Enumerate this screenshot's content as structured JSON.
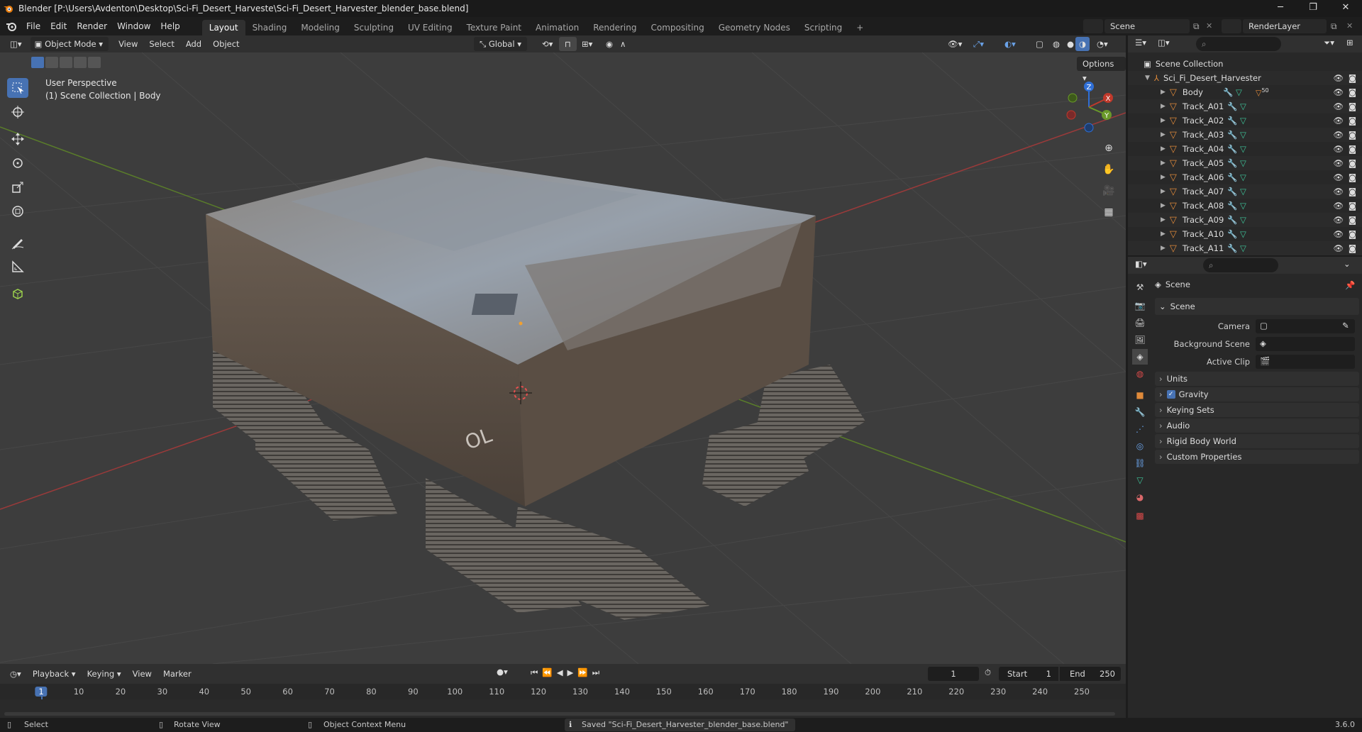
{
  "window": {
    "title": "Blender [P:\\Users\\Avdenton\\Desktop\\Sci-Fi_Desert_Harveste\\Sci-Fi_Desert_Harvester_blender_base.blend]",
    "minimize": "─",
    "maximize": "❐",
    "close": "✕"
  },
  "menus": [
    "File",
    "Edit",
    "Render",
    "Window",
    "Help"
  ],
  "workspaces": [
    "Layout",
    "Shading",
    "Modeling",
    "Sculpting",
    "UV Editing",
    "Texture Paint",
    "Animation",
    "Rendering",
    "Compositing",
    "Geometry Nodes",
    "Scripting"
  ],
  "workspace_add": "+",
  "scene_name": "Scene",
  "view_layer": "RenderLayer",
  "viewport_header": {
    "mode": "Object Mode",
    "menus": [
      "View",
      "Select",
      "Add",
      "Object"
    ],
    "transform_orientation": "Global",
    "options": "Options"
  },
  "viewport_overlay": {
    "perspective": "User Perspective",
    "collection_info": "(1) Scene Collection | Body",
    "gizmo_labels": {
      "z": "Z",
      "y": "Y",
      "x": "X"
    }
  },
  "outliner": {
    "root": "Scene Collection",
    "collection": "Sci_Fi_Desert_Harvester",
    "objects": [
      "Body",
      "Track_A01",
      "Track_A02",
      "Track_A03",
      "Track_A04",
      "Track_A05",
      "Track_A06",
      "Track_A07",
      "Track_A08",
      "Track_A09",
      "Track_A10",
      "Track_A11"
    ],
    "body_badge": "50"
  },
  "properties": {
    "context_title": "Scene",
    "panel_scene": "Scene",
    "camera_label": "Camera",
    "background_scene_label": "Background Scene",
    "active_clip_label": "Active Clip",
    "panels": [
      "Units",
      "Gravity",
      "Keying Sets",
      "Audio",
      "Rigid Body World",
      "Custom Properties"
    ],
    "gravity_checked": true
  },
  "timeline": {
    "menus": [
      "Playback",
      "Keying",
      "View",
      "Marker"
    ],
    "current_frame": "1",
    "start_label": "Start",
    "start": "1",
    "end_label": "End",
    "end": "250",
    "ticks": [
      "1",
      "10",
      "20",
      "30",
      "40",
      "50",
      "60",
      "70",
      "80",
      "90",
      "100",
      "110",
      "120",
      "130",
      "140",
      "150",
      "160",
      "170",
      "180",
      "190",
      "200",
      "210",
      "220",
      "230",
      "240",
      "250"
    ]
  },
  "statusbar": {
    "select": "Select",
    "rotate": "Rotate View",
    "context_menu": "Object Context Menu",
    "message": "Saved \"Sci-Fi_Desert_Harvester_blender_base.blend\"",
    "version": "3.6.0"
  },
  "colors": {
    "accent": "#4772b3",
    "axis_x": "#c0392b",
    "axis_y": "#6a9a2a",
    "axis_z": "#2f6fd6",
    "mesh_icon": "#e08a3a",
    "modifier_icon": "#6aa2e8",
    "data_icon": "#3ec49a"
  }
}
